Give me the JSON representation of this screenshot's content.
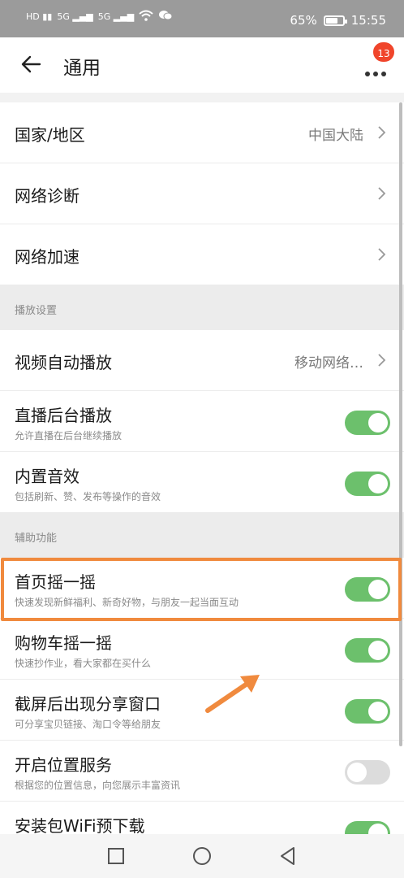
{
  "status_bar": {
    "battery": "65%",
    "time": "15:55",
    "battery_level": 0.65
  },
  "header": {
    "title": "通用",
    "badge_count": "13"
  },
  "groups": {
    "general": [
      {
        "label": "国家/地区",
        "value": "中国大陆"
      },
      {
        "label": "网络诊断"
      },
      {
        "label": "网络加速"
      }
    ],
    "playback_title": "播放设置",
    "playback": [
      {
        "label": "视频自动播放",
        "value": "移动网络…"
      },
      {
        "label": "直播后台播放",
        "sub": "允许直播在后台继续播放",
        "on": true
      },
      {
        "label": "内置音效",
        "sub": "包括刷新、赞、发布等操作的音效",
        "on": true
      }
    ],
    "assist_title": "辅助功能",
    "assist": [
      {
        "label": "首页摇一摇",
        "sub": "快速发现新鲜福利、新奇好物，与朋友一起当面互动",
        "on": true
      },
      {
        "label": "购物车摇一摇",
        "sub": "快速抄作业，看大家都在买什么",
        "on": true
      },
      {
        "label": "截屏后出现分享窗口",
        "sub": "可分享宝贝链接、淘口令等给朋友",
        "on": true
      },
      {
        "label": "开启位置服务",
        "sub": "根据您的位置信息，向您展示丰富资讯",
        "on": false
      },
      {
        "label": "安装包WiFi预下载",
        "on": true
      }
    ]
  },
  "colors": {
    "toggle_on": "#6cc06c",
    "toggle_off": "#dcdcdc",
    "highlight": "#f08a3e",
    "badge": "#f0452b"
  }
}
